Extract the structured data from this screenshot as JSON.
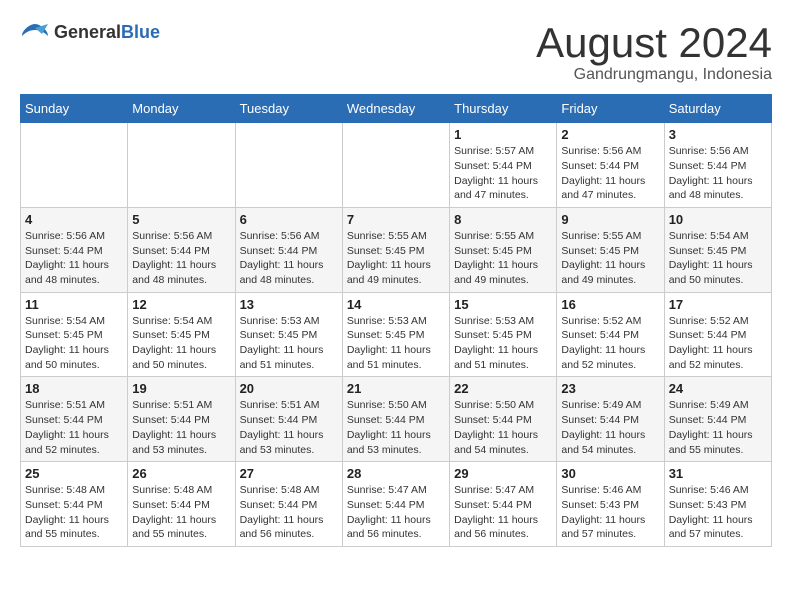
{
  "header": {
    "logo_general": "General",
    "logo_blue": "Blue",
    "month_title": "August 2024",
    "location": "Gandrungmangu, Indonesia"
  },
  "days_of_week": [
    "Sunday",
    "Monday",
    "Tuesday",
    "Wednesday",
    "Thursday",
    "Friday",
    "Saturday"
  ],
  "weeks": [
    [
      {
        "day": "",
        "info": ""
      },
      {
        "day": "",
        "info": ""
      },
      {
        "day": "",
        "info": ""
      },
      {
        "day": "",
        "info": ""
      },
      {
        "day": "1",
        "info": "Sunrise: 5:57 AM\nSunset: 5:44 PM\nDaylight: 11 hours\nand 47 minutes."
      },
      {
        "day": "2",
        "info": "Sunrise: 5:56 AM\nSunset: 5:44 PM\nDaylight: 11 hours\nand 47 minutes."
      },
      {
        "day": "3",
        "info": "Sunrise: 5:56 AM\nSunset: 5:44 PM\nDaylight: 11 hours\nand 48 minutes."
      }
    ],
    [
      {
        "day": "4",
        "info": "Sunrise: 5:56 AM\nSunset: 5:44 PM\nDaylight: 11 hours\nand 48 minutes."
      },
      {
        "day": "5",
        "info": "Sunrise: 5:56 AM\nSunset: 5:44 PM\nDaylight: 11 hours\nand 48 minutes."
      },
      {
        "day": "6",
        "info": "Sunrise: 5:56 AM\nSunset: 5:44 PM\nDaylight: 11 hours\nand 48 minutes."
      },
      {
        "day": "7",
        "info": "Sunrise: 5:55 AM\nSunset: 5:45 PM\nDaylight: 11 hours\nand 49 minutes."
      },
      {
        "day": "8",
        "info": "Sunrise: 5:55 AM\nSunset: 5:45 PM\nDaylight: 11 hours\nand 49 minutes."
      },
      {
        "day": "9",
        "info": "Sunrise: 5:55 AM\nSunset: 5:45 PM\nDaylight: 11 hours\nand 49 minutes."
      },
      {
        "day": "10",
        "info": "Sunrise: 5:54 AM\nSunset: 5:45 PM\nDaylight: 11 hours\nand 50 minutes."
      }
    ],
    [
      {
        "day": "11",
        "info": "Sunrise: 5:54 AM\nSunset: 5:45 PM\nDaylight: 11 hours\nand 50 minutes."
      },
      {
        "day": "12",
        "info": "Sunrise: 5:54 AM\nSunset: 5:45 PM\nDaylight: 11 hours\nand 50 minutes."
      },
      {
        "day": "13",
        "info": "Sunrise: 5:53 AM\nSunset: 5:45 PM\nDaylight: 11 hours\nand 51 minutes."
      },
      {
        "day": "14",
        "info": "Sunrise: 5:53 AM\nSunset: 5:45 PM\nDaylight: 11 hours\nand 51 minutes."
      },
      {
        "day": "15",
        "info": "Sunrise: 5:53 AM\nSunset: 5:45 PM\nDaylight: 11 hours\nand 51 minutes."
      },
      {
        "day": "16",
        "info": "Sunrise: 5:52 AM\nSunset: 5:44 PM\nDaylight: 11 hours\nand 52 minutes."
      },
      {
        "day": "17",
        "info": "Sunrise: 5:52 AM\nSunset: 5:44 PM\nDaylight: 11 hours\nand 52 minutes."
      }
    ],
    [
      {
        "day": "18",
        "info": "Sunrise: 5:51 AM\nSunset: 5:44 PM\nDaylight: 11 hours\nand 52 minutes."
      },
      {
        "day": "19",
        "info": "Sunrise: 5:51 AM\nSunset: 5:44 PM\nDaylight: 11 hours\nand 53 minutes."
      },
      {
        "day": "20",
        "info": "Sunrise: 5:51 AM\nSunset: 5:44 PM\nDaylight: 11 hours\nand 53 minutes."
      },
      {
        "day": "21",
        "info": "Sunrise: 5:50 AM\nSunset: 5:44 PM\nDaylight: 11 hours\nand 53 minutes."
      },
      {
        "day": "22",
        "info": "Sunrise: 5:50 AM\nSunset: 5:44 PM\nDaylight: 11 hours\nand 54 minutes."
      },
      {
        "day": "23",
        "info": "Sunrise: 5:49 AM\nSunset: 5:44 PM\nDaylight: 11 hours\nand 54 minutes."
      },
      {
        "day": "24",
        "info": "Sunrise: 5:49 AM\nSunset: 5:44 PM\nDaylight: 11 hours\nand 55 minutes."
      }
    ],
    [
      {
        "day": "25",
        "info": "Sunrise: 5:48 AM\nSunset: 5:44 PM\nDaylight: 11 hours\nand 55 minutes."
      },
      {
        "day": "26",
        "info": "Sunrise: 5:48 AM\nSunset: 5:44 PM\nDaylight: 11 hours\nand 55 minutes."
      },
      {
        "day": "27",
        "info": "Sunrise: 5:48 AM\nSunset: 5:44 PM\nDaylight: 11 hours\nand 56 minutes."
      },
      {
        "day": "28",
        "info": "Sunrise: 5:47 AM\nSunset: 5:44 PM\nDaylight: 11 hours\nand 56 minutes."
      },
      {
        "day": "29",
        "info": "Sunrise: 5:47 AM\nSunset: 5:44 PM\nDaylight: 11 hours\nand 56 minutes."
      },
      {
        "day": "30",
        "info": "Sunrise: 5:46 AM\nSunset: 5:43 PM\nDaylight: 11 hours\nand 57 minutes."
      },
      {
        "day": "31",
        "info": "Sunrise: 5:46 AM\nSunset: 5:43 PM\nDaylight: 11 hours\nand 57 minutes."
      }
    ]
  ]
}
